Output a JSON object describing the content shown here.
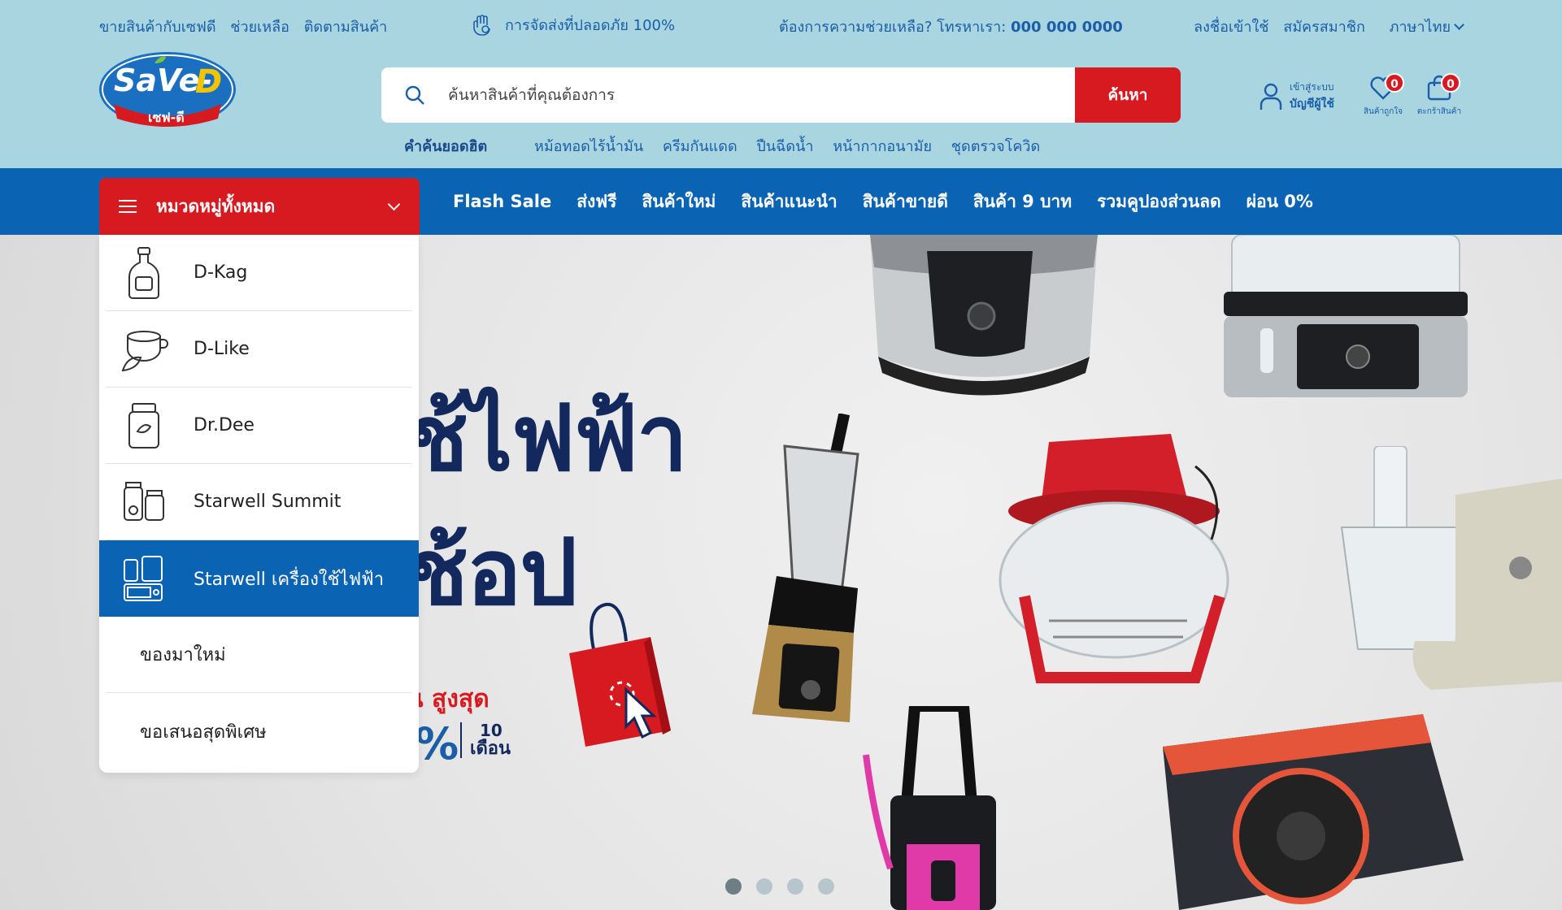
{
  "topbar": {
    "left_links": [
      "ขายสินค้ากับเซฟดี",
      "ช่วยเหลือ",
      "ติดตามสินค้า"
    ],
    "center_text": "การจัดส่งที่ปลอดภัย 100%",
    "help_text": "ต้องการความช่วยเหลือ? โทรหาเรา: ",
    "phone": "000 000 0000",
    "right_links": [
      "ลงชื่อเข้าใช้",
      "สมัครสมาชิก",
      "ภาษาไทย"
    ]
  },
  "logo": {
    "text": "SaVe-D",
    "subtext": "เซฟ-ดี"
  },
  "search": {
    "placeholder": "ค้นหาสินค้าที่คุณต้องการ",
    "button_label": "ค้นหา"
  },
  "hot_searches": {
    "label": "คำค้นยอดฮิต",
    "items": [
      "หม้อทอดไร้น้ำมัน",
      "ครีมกันแดด",
      "ปืนฉีดน้ำ",
      "หน้ากากอนามัย",
      "ชุดตรวจโควิด"
    ]
  },
  "account": {
    "line1": "เข้าสู่ระบบ",
    "line2": "บัญชีผู้ใช้"
  },
  "wishlist": {
    "label": "สินค้าถูกใจ",
    "count": "0"
  },
  "cart": {
    "label": "ตะกร้าสินค้า",
    "count": "0"
  },
  "category_button": {
    "label": "หมวดหมู่ทั้งหมด"
  },
  "nav": {
    "items": [
      "Flash Sale",
      "ส่งฟรี",
      "สินค้าใหม่",
      "สินค้าแนะนำ",
      "สินค้าขายดี",
      "สินค้า 9 บาท",
      "รวมคูปองส่วนลด",
      "ผ่อน 0%"
    ]
  },
  "categories": [
    {
      "label": "D-Kag",
      "icon": "bottle-icon"
    },
    {
      "label": "D-Like",
      "icon": "tea-cup-icon"
    },
    {
      "label": "Dr.Dee",
      "icon": "jar-icon"
    },
    {
      "label": "Starwell Summit",
      "icon": "supplement-bottles-icon"
    },
    {
      "label": "Starwell เครื่องใช้ไฟฟ้า",
      "icon": "appliance-icon",
      "active": true
    },
    {
      "label": "ของมาใหม่"
    },
    {
      "label": "ขอเสนอสุดพิเศษ"
    }
  ],
  "hero": {
    "headline_line1": "ช้ไฟฟ้า",
    "headline_line2": "ช้อป",
    "sub": "น สูงสุด",
    "percent": "%",
    "months_num": "10",
    "months_label": "เดือน",
    "slides": 4,
    "active_slide": 1
  },
  "colors": {
    "header_bg": "#a9d5e1",
    "nav_bg": "#0b63b4",
    "accent_red": "#d71920",
    "text_blue": "#1a5ea8"
  }
}
